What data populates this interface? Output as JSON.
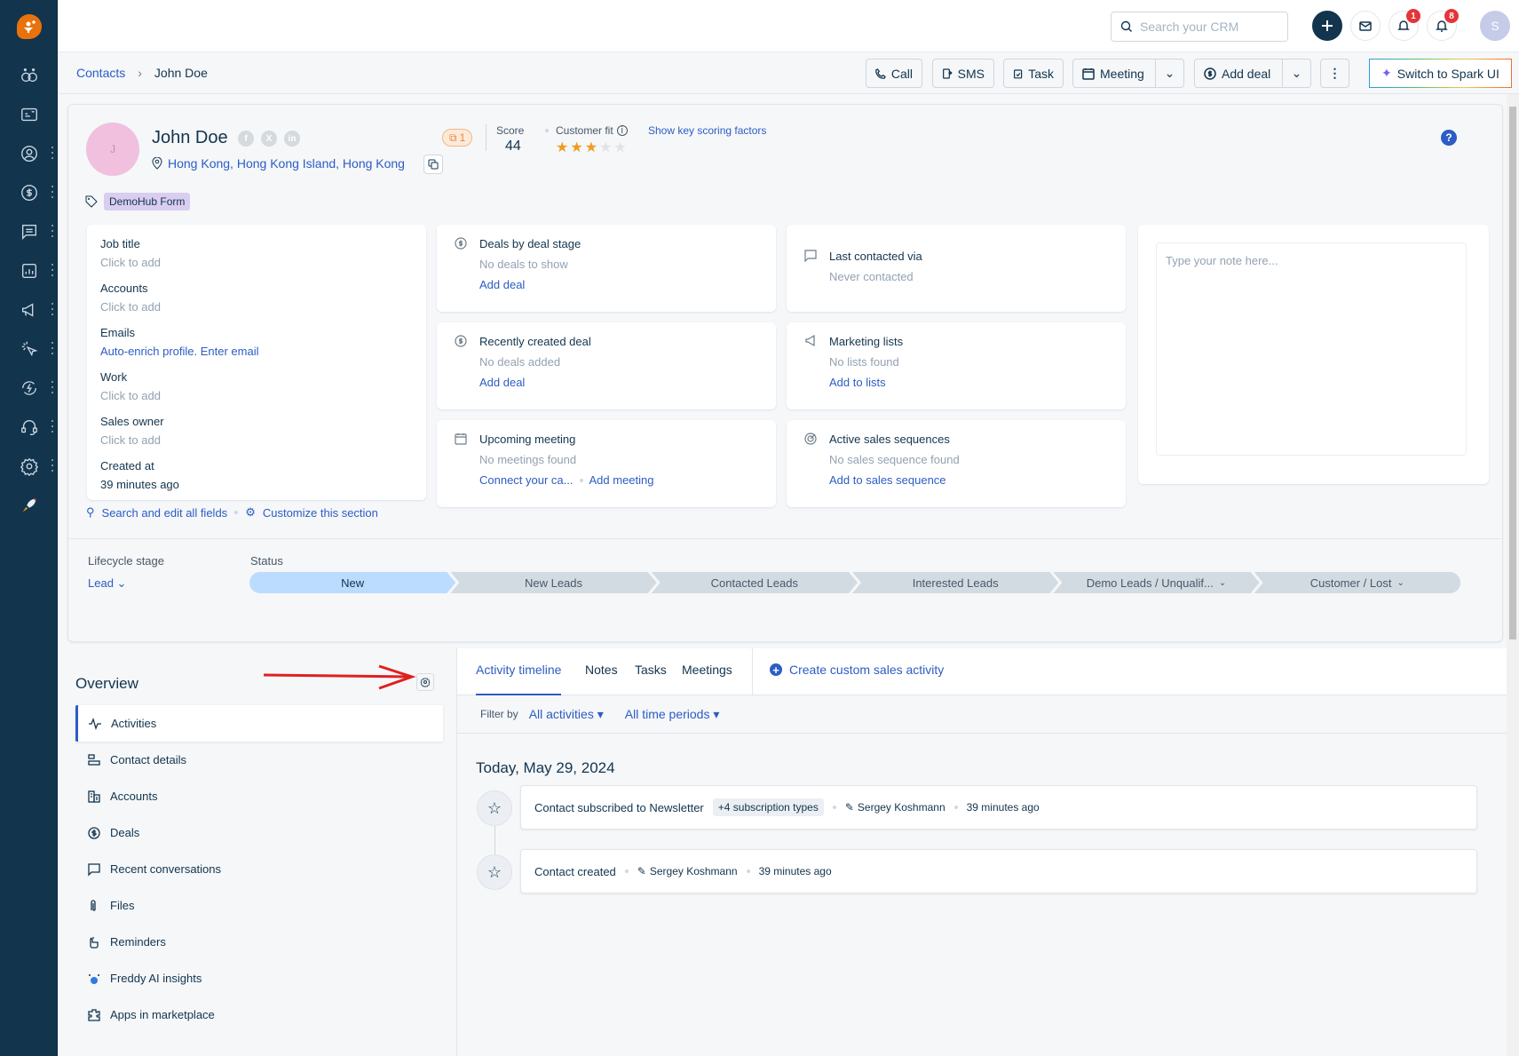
{
  "topbar": {
    "search_placeholder": "Search your CRM",
    "notif_badge_1": "1",
    "notif_badge_2": "8",
    "avatar_initial": "S"
  },
  "sidebar": {
    "items": [
      {
        "icon": "freddy-icon"
      },
      {
        "icon": "inbox-card-icon"
      },
      {
        "icon": "contacts-icon"
      },
      {
        "icon": "deals-icon"
      },
      {
        "icon": "conversations-icon"
      },
      {
        "icon": "reports-icon"
      },
      {
        "icon": "marketing-icon"
      },
      {
        "icon": "cursor-click-icon"
      },
      {
        "icon": "automation-icon"
      },
      {
        "icon": "support-headset-icon"
      },
      {
        "icon": "settings-icon"
      },
      {
        "icon": "rocket-icon"
      }
    ]
  },
  "breadcrumb": {
    "parent": "Contacts",
    "current": "John Doe"
  },
  "actions": {
    "call": "Call",
    "sms": "SMS",
    "task": "Task",
    "meeting": "Meeting",
    "add_deal": "Add deal",
    "spark": "Switch to Spark UI"
  },
  "profile": {
    "avatar_initial": "J",
    "name": "John Doe",
    "location": "Hong Kong, Hong Kong Island, Hong Kong",
    "tag": "DemoHub Form",
    "duplicates": "1",
    "score_label": "Score",
    "score": "44",
    "fit_label": "Customer fit",
    "fit_stars": 3,
    "fit_max": 5,
    "scoring_link": "Show key scoring factors"
  },
  "fields": [
    {
      "label": "Job title",
      "value": "Click to add"
    },
    {
      "label": "Accounts",
      "value": "Click to add"
    },
    {
      "label": "Emails",
      "value": "Auto-enrich profile. Enter email"
    },
    {
      "label": "Work",
      "value": "Click to add"
    },
    {
      "label": "Sales owner",
      "value": "Click to add"
    },
    {
      "label": "Created at",
      "value": "39 minutes ago"
    }
  ],
  "widgets": {
    "deals_stage": {
      "title": "Deals by deal stage",
      "sub": "No deals to show",
      "link": "Add deal"
    },
    "recent_deal": {
      "title": "Recently created deal",
      "sub": "No deals added",
      "link": "Add deal"
    },
    "meeting": {
      "title": "Upcoming meeting",
      "sub": "No meetings found",
      "link1": "Connect your ca...",
      "link2": "Add meeting"
    },
    "last_contacted": {
      "title": "Last contacted via",
      "sub": "Never contacted"
    },
    "marketing": {
      "title": "Marketing lists",
      "sub": "No lists found",
      "link": "Add to lists"
    },
    "sequences": {
      "title": "Active sales sequences",
      "sub": "No sales sequence found",
      "link": "Add to sales sequence"
    },
    "note_placeholder": "Type your note here..."
  },
  "links": {
    "search_fields": "Search and edit all fields",
    "customize": "Customize this section"
  },
  "lifecycle": {
    "label": "Lifecycle stage",
    "value": "Lead"
  },
  "status": {
    "label": "Status",
    "stages": [
      "New",
      "New Leads",
      "Contacted Leads",
      "Interested Leads",
      "Demo Leads / Unqualif...",
      "Customer / Lost"
    ],
    "active": "New"
  },
  "overview": {
    "title": "Overview",
    "items": [
      "Activities",
      "Contact details",
      "Accounts",
      "Deals",
      "Recent conversations",
      "Files",
      "Reminders",
      "Freddy AI insights",
      "Apps in marketplace"
    ]
  },
  "timeline": {
    "tabs": [
      "Activity timeline",
      "Notes",
      "Tasks",
      "Meetings"
    ],
    "custom": "Create custom sales activity",
    "filter_label": "Filter by",
    "filter_activities": "All activities",
    "filter_time": "All time periods",
    "date": "Today, May 29, 2024",
    "entries": [
      {
        "title": "Contact subscribed to Newsletter",
        "chip": "+4 subscription types",
        "user": "Sergey Koshmann",
        "time": "39 minutes ago"
      },
      {
        "title": "Contact created",
        "user": "Sergey Koshmann",
        "time": "39 minutes ago"
      }
    ]
  }
}
